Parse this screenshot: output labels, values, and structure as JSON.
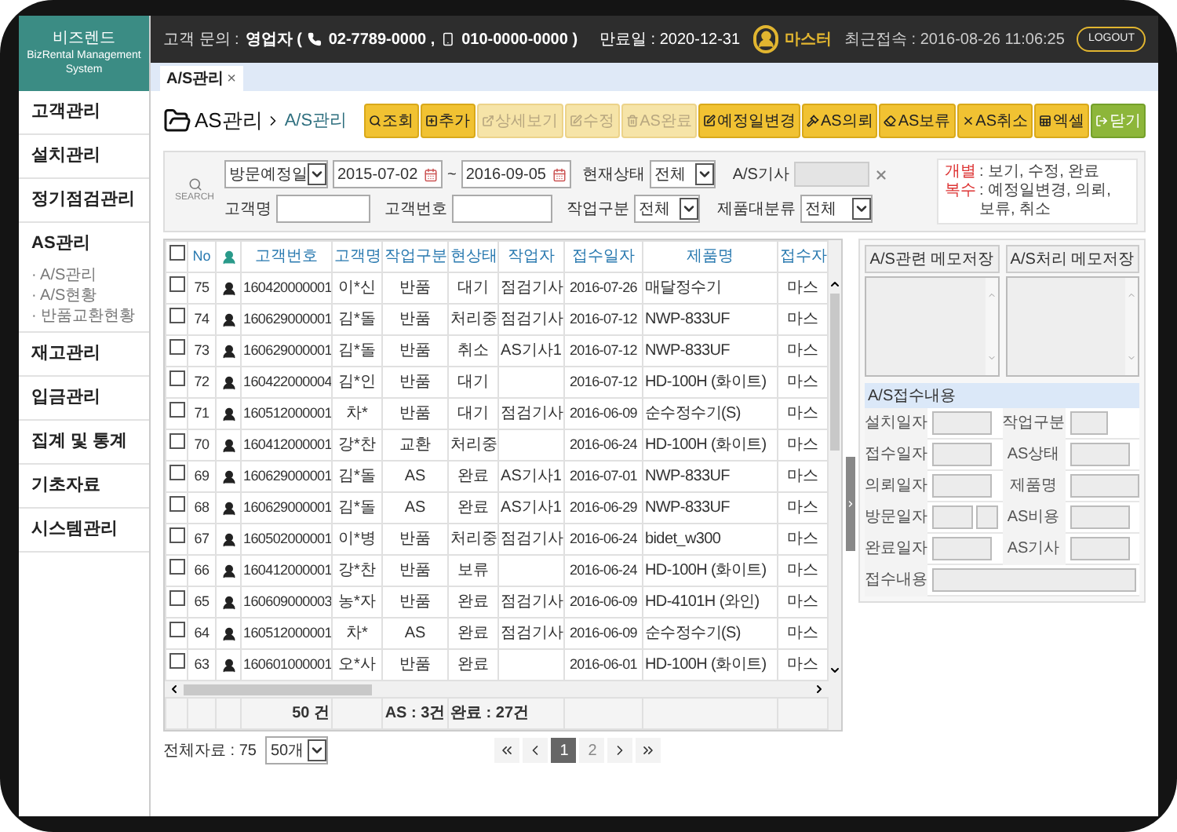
{
  "brand": {
    "name": "비즈렌드",
    "subtitle": "BizRental Management System"
  },
  "header": {
    "contact_label": "고객 문의 :",
    "contact_name": "영업자 (",
    "phone": "02-7789-0000 ,",
    "mobile": "010-0000-0000 )",
    "expiry": "만료일 : 2020-12-31",
    "user": "마스터",
    "last_login": "최근접속 : 2016-08-26 11:06:25",
    "logout": "LOGOUT"
  },
  "tabs": [
    {
      "label": "A/S관리",
      "close": "×",
      "selected": true
    }
  ],
  "sidebar": {
    "items": [
      {
        "label": "고객관리"
      },
      {
        "label": "설치관리"
      },
      {
        "label": "정기점검관리"
      },
      {
        "label": "AS관리",
        "children": [
          {
            "label": "· A/S관리"
          },
          {
            "label": "· A/S현황"
          },
          {
            "label": "· 반품교환현황"
          }
        ]
      },
      {
        "label": "재고관리"
      },
      {
        "label": "입금관리"
      },
      {
        "label": "집계 및 통계"
      },
      {
        "label": "기초자료"
      },
      {
        "label": "시스템관리"
      }
    ]
  },
  "breadcrumb": {
    "section": "AS관리",
    "page": "A/S관리"
  },
  "toolbar": [
    {
      "label": "조회",
      "disabled": false,
      "kind": "action"
    },
    {
      "label": "추가",
      "disabled": false,
      "kind": "action"
    },
    {
      "label": "상세보기",
      "disabled": true,
      "kind": "action"
    },
    {
      "label": "수정",
      "disabled": true,
      "kind": "action"
    },
    {
      "label": "AS완료",
      "disabled": true,
      "kind": "action"
    },
    {
      "label": "예정일변경",
      "disabled": false,
      "kind": "action"
    },
    {
      "label": "AS의뢰",
      "disabled": false,
      "kind": "action"
    },
    {
      "label": "AS보류",
      "disabled": false,
      "kind": "action"
    },
    {
      "label": "AS취소",
      "disabled": false,
      "kind": "action"
    },
    {
      "label": "엑셀",
      "disabled": false,
      "kind": "action"
    },
    {
      "label": "닫기",
      "disabled": false,
      "kind": "exit"
    }
  ],
  "search": {
    "label": "SEARCH",
    "date_type": "방문예정일",
    "date_from": "2015-07-02",
    "tilde": "~",
    "date_to": "2016-09-05",
    "status_label": "현재상태",
    "status_value": "전체",
    "tech_label": "A/S기사",
    "customer_name_label": "고객명",
    "customer_no_label": "고객번호",
    "work_type_label": "작업구분",
    "work_type_value": "전체",
    "category_label": "제품대분류",
    "category_value": "전체"
  },
  "help": [
    {
      "key": "개별",
      "text": ": 보기, 수정, 완료"
    },
    {
      "key": "복수",
      "text": ": 예정일변경, 의뢰, 보류, 취소"
    }
  ],
  "table": {
    "select_all_checked": false,
    "columns": [
      "No",
      "고객번호",
      "고객명",
      "작업구분",
      "현상태",
      "작업자",
      "접수일자",
      "제품명",
      "접수자"
    ],
    "rows": [
      {
        "checked": false,
        "no": "75",
        "customer_no": "160420000001",
        "name": "이*신",
        "work_type": "반품",
        "status": "대기",
        "worker": "점검기사",
        "date": "2016-07-26",
        "product": "매달정수기",
        "receiver": "마스"
      },
      {
        "checked": false,
        "no": "74",
        "customer_no": "160629000001",
        "name": "김*돌",
        "work_type": "반품",
        "status": "처리중",
        "worker": "점검기사",
        "date": "2016-07-12",
        "product": "NWP-833UF",
        "receiver": "마스"
      },
      {
        "checked": false,
        "no": "73",
        "customer_no": "160629000001",
        "name": "김*돌",
        "work_type": "반품",
        "status": "취소",
        "worker": "AS기사1",
        "date": "2016-07-12",
        "product": "NWP-833UF",
        "receiver": "마스"
      },
      {
        "checked": false,
        "no": "72",
        "customer_no": "160422000004",
        "name": "김*인",
        "work_type": "반품",
        "status": "대기",
        "date": "2016-07-12",
        "product": "HD-100H (화이트)",
        "receiver": "마스"
      },
      {
        "checked": false,
        "no": "71",
        "customer_no": "160512000001",
        "name": "차*",
        "work_type": "반품",
        "status": "대기",
        "worker": "점검기사",
        "date": "2016-06-09",
        "product": "순수정수기(S)",
        "receiver": "마스"
      },
      {
        "checked": false,
        "no": "70",
        "customer_no": "160412000001",
        "name": "강*찬",
        "work_type": "교환",
        "status": "처리중",
        "date": "2016-06-24",
        "product": "HD-100H (화이트)",
        "receiver": "마스"
      },
      {
        "checked": false,
        "no": "69",
        "customer_no": "160629000001",
        "name": "김*돌",
        "work_type": "AS",
        "status": "완료",
        "worker": "AS기사1",
        "date": "2016-07-01",
        "product": "NWP-833UF",
        "receiver": "마스"
      },
      {
        "checked": false,
        "no": "68",
        "customer_no": "160629000001",
        "name": "김*돌",
        "work_type": "AS",
        "status": "완료",
        "worker": "AS기사1",
        "date": "2016-06-29",
        "product": "NWP-833UF",
        "receiver": "마스"
      },
      {
        "checked": false,
        "no": "67",
        "customer_no": "160502000001",
        "name": "이*병",
        "work_type": "반품",
        "status": "처리중",
        "worker": "점검기사",
        "date": "2016-06-24",
        "product": "bidet_w300",
        "receiver": "마스"
      },
      {
        "checked": false,
        "no": "66",
        "customer_no": "160412000001",
        "name": "강*찬",
        "work_type": "반품",
        "status": "보류",
        "date": "2016-06-24",
        "product": "HD-100H (화이트)",
        "receiver": "마스"
      },
      {
        "checked": false,
        "no": "65",
        "customer_no": "160609000003",
        "name": "농*자",
        "work_type": "반품",
        "status": "완료",
        "worker": "점검기사",
        "date": "2016-06-09",
        "product": "HD-4101H (와인)",
        "receiver": "마스"
      },
      {
        "checked": false,
        "no": "64",
        "customer_no": "160512000001",
        "name": "차*",
        "work_type": "AS",
        "status": "완료",
        "worker": "점검기사",
        "date": "2016-06-09",
        "product": "순수정수기(S)",
        "receiver": "마스"
      },
      {
        "checked": false,
        "no": "63",
        "customer_no": "160601000001",
        "name": "오*사",
        "work_type": "반품",
        "status": "완료",
        "date": "2016-06-01",
        "product": "HD-100H (화이트)",
        "receiver": "마스"
      }
    ],
    "totals": {
      "count": "50 건",
      "as": "AS : 3건",
      "done": "완료 : 27건"
    }
  },
  "pagination": {
    "total": "전체자료 : 75",
    "page_size": "50개",
    "pages": [
      {
        "label": "1",
        "selected": true
      },
      {
        "label": "2",
        "selected": false
      }
    ]
  },
  "memos": [
    {
      "title": "A/S관련 메모저장"
    },
    {
      "title": "A/S처리 메모저장"
    }
  ],
  "receipt": {
    "title": "A/S접수내용",
    "rows": [
      [
        {
          "label": "설치일자",
          "kind": "medium"
        },
        {
          "label": "작업구분",
          "kind": "short"
        }
      ],
      [
        {
          "label": "접수일자",
          "kind": "medium"
        },
        {
          "label": "AS상태",
          "kind": "medium"
        }
      ],
      [
        {
          "label": "의뢰일자",
          "kind": "medium"
        },
        {
          "label": "제품명",
          "kind": "long"
        }
      ],
      [
        {
          "label": "방문일자",
          "kind": "double"
        },
        {
          "label": "AS비용",
          "kind": "medium"
        }
      ],
      [
        {
          "label": "완료일자",
          "kind": "medium"
        },
        {
          "label": "AS기사",
          "kind": "medium"
        }
      ],
      [
        {
          "label": "접수내용",
          "kind": "wide"
        }
      ]
    ]
  }
}
